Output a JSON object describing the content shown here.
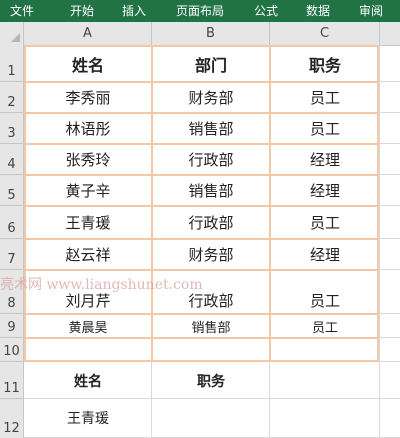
{
  "ribbon": {
    "tabs": [
      "文件",
      "开始",
      "插入",
      "页面布局",
      "公式",
      "数据",
      "审阅"
    ]
  },
  "columns": [
    "A",
    "B",
    "C"
  ],
  "rows": [
    "1",
    "2",
    "3",
    "4",
    "5",
    "6",
    "7",
    "8",
    "9",
    "10",
    "11",
    "12"
  ],
  "table": {
    "headers": [
      "姓名",
      "部门",
      "职务"
    ],
    "records": [
      [
        "李秀丽",
        "财务部",
        "员工"
      ],
      [
        "林语彤",
        "销售部",
        "员工"
      ],
      [
        "张秀玲",
        "行政部",
        "经理"
      ],
      [
        "黄子辛",
        "销售部",
        "经理"
      ],
      [
        "王青瑗",
        "行政部",
        "员工"
      ],
      [
        "赵云祥",
        "财务部",
        "经理"
      ],
      [
        "刘月芹",
        "行政部",
        "员工"
      ],
      [
        "黄晨昊",
        "销售部",
        "员工"
      ]
    ]
  },
  "lookup": {
    "name_label": "姓名",
    "title_label": "职务",
    "name_value": "王青瑗",
    "title_value": ""
  },
  "watermark": "亮术网 www.liangshunet.com",
  "colors": {
    "ribbon": "#217346",
    "table_border": "#f6c7a5",
    "gridline": "#dadada"
  }
}
